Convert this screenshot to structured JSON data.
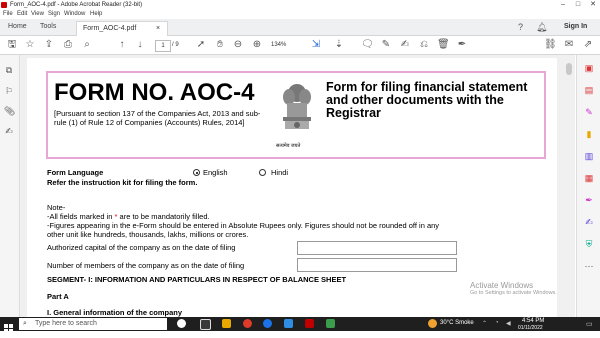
{
  "window": {
    "title": "Form_AOC-4.pdf - Adobe Acrobat Reader (32-bit)"
  },
  "menu": [
    "File",
    "Edit",
    "View",
    "Sign",
    "Window",
    "Help"
  ],
  "tabs": {
    "home": "Home",
    "tools": "Tools",
    "doc": "Form_AOC-4.pdf",
    "close": "×",
    "sign_in": "Sign In"
  },
  "toolbar": {
    "page_current": "1",
    "page_total": "/ 9",
    "zoom": "134%"
  },
  "form": {
    "title": "FORM NO. AOC-4",
    "subtitle": "[Pursuant to section 137 of the Companies Act, 2013 and sub-rule (1) of Rule 12 of Companies (Accounts) Rules, 2014]",
    "emblem_caption": "सत्यमेव जयते",
    "right_heading": "Form for filing financial statement and other documents with the Registrar",
    "language_label": "Form Language",
    "language_options": [
      "English",
      "Hindi"
    ],
    "instruction": "Refer the instruction kit for filing the form.",
    "note_title": "Note-",
    "note_line1_a": "-All fields marked in ",
    "note_star": "*",
    "note_line1_b": " are to be mandatorily filled.",
    "note_line2": "-Figures appearing in the e-Form should be entered in Absolute Rupees only. Figures should not be rounded off in any",
    "note_line3": "other unit like hundreds, thousands, lakhs, millions or crores.",
    "authorized_capital_label": "Authorized capital of the company as on the date of filing",
    "members_label": "Number of members of the company as on the date of filing",
    "segment_heading": "SEGMENT- I: INFORMATION AND PARTICULARS IN RESPECT OF BALANCE SHEET",
    "part_a": "Part A",
    "general_info": "I. General information of the company"
  },
  "watermark": {
    "line1": "Activate Windows",
    "line2": "Go to Settings to activate Windows."
  },
  "taskbar": {
    "search": "Type here to search",
    "weather": "30°C Smoke",
    "time": "4:54 PM",
    "date": "01/11/2022"
  },
  "colors": {
    "accent": "#e8a6d6",
    "taskbar": "#1f1f1f",
    "pdf_red": "#c00000"
  }
}
